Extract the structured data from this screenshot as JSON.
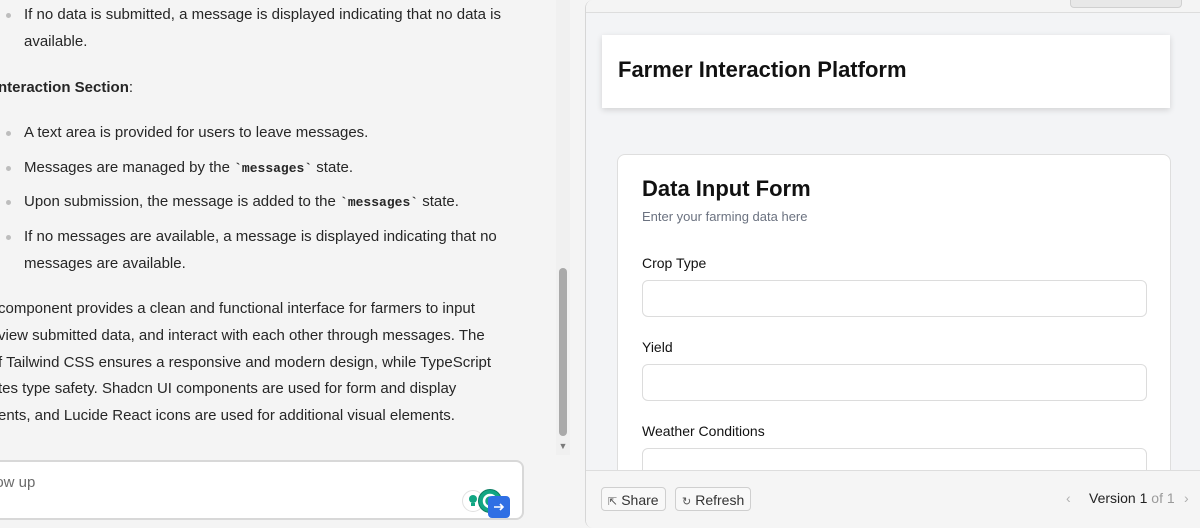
{
  "chat": {
    "bullets_a": [
      {
        "line1": "If no data is submitted, a message is displayed indicating that no data is",
        "line2": "available."
      }
    ],
    "section_heading": "nteraction Section",
    "section_colon": ":",
    "bullets_b": [
      {
        "text": "A text area is provided for users to leave messages."
      },
      {
        "pre": "Messages are managed by the ",
        "code": "`messages`",
        "post": " state."
      },
      {
        "pre": "Upon submission, the message is added to the ",
        "code": "`messages`",
        "post": " state."
      },
      {
        "line1": "If no messages are available, a message is displayed indicating that no",
        "line2": "messages are available."
      }
    ],
    "paragraph_lines": [
      "component provides a clean and functional interface for farmers to input",
      "view submitted data, and interact with each other through messages. The",
      "f Tailwind CSS ensures a responsive and modern design, while TypeScript",
      "tes type safety. Shadcn UI components are used for form and display",
      "ents, and Lucide React icons are used for additional visual elements."
    ],
    "input_placeholder": "low up"
  },
  "artifact": {
    "app_title": "Farmer Interaction Platform",
    "card_title": "Data Input Form",
    "card_description": "Enter your farming data here",
    "fields": [
      {
        "label": "Crop Type",
        "value": ""
      },
      {
        "label": "Yield",
        "value": ""
      },
      {
        "label": "Weather Conditions",
        "value": ""
      }
    ],
    "footer": {
      "share_label": "Share",
      "refresh_label": "Refresh",
      "version_word": "Version",
      "version_current": "1",
      "version_of": "of",
      "version_total": "1"
    }
  },
  "colors": {
    "accent_blue": "#2f6fe4",
    "grammarly_green": "#11a683"
  }
}
